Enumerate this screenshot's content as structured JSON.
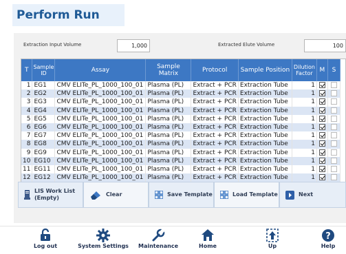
{
  "page": {
    "title": "Perform Run"
  },
  "volumes": {
    "extraction_input_label": "Extraction Input Volume",
    "extraction_input_value": "1,000",
    "extracted_elute_label": "Extracted Elute Volume",
    "extracted_elute_value": "100"
  },
  "table": {
    "headers": [
      "T",
      "Sample ID",
      "Assay",
      "Sample Matrix",
      "Protocol",
      "Sample Position",
      "Dilution Factor",
      "M",
      "S"
    ],
    "rows": [
      {
        "t": "1",
        "sample_id": "EG1",
        "assay": "CMV ELITe_PL_1000_100_01",
        "matrix": "Plasma (PL)",
        "protocol": "Extract + PCR",
        "position": "Extraction Tube",
        "dilution": "1",
        "m": true,
        "s": false
      },
      {
        "t": "2",
        "sample_id": "EG2",
        "assay": "CMV ELITe_PL_1000_100_01",
        "matrix": "Plasma (PL)",
        "protocol": "Extract + PCR",
        "position": "Extraction Tube",
        "dilution": "1",
        "m": true,
        "s": false
      },
      {
        "t": "3",
        "sample_id": "EG3",
        "assay": "CMV ELITe_PL_1000_100_01",
        "matrix": "Plasma (PL)",
        "protocol": "Extract + PCR",
        "position": "Extraction Tube",
        "dilution": "1",
        "m": true,
        "s": false
      },
      {
        "t": "4",
        "sample_id": "EG4",
        "assay": "CMV ELITe_PL_1000_100_01",
        "matrix": "Plasma (PL)",
        "protocol": "Extract + PCR",
        "position": "Extraction Tube",
        "dilution": "1",
        "m": true,
        "s": false
      },
      {
        "t": "5",
        "sample_id": "EG5",
        "assay": "CMV ELITe_PL_1000_100_01",
        "matrix": "Plasma (PL)",
        "protocol": "Extract + PCR",
        "position": "Extraction Tube",
        "dilution": "1",
        "m": true,
        "s": false
      },
      {
        "t": "6",
        "sample_id": "EG6",
        "assay": "CMV ELITe_PL_1000_100_01",
        "matrix": "Plasma (PL)",
        "protocol": "Extract + PCR",
        "position": "Extraction Tube",
        "dilution": "1",
        "m": true,
        "s": false
      },
      {
        "t": "7",
        "sample_id": "EG7",
        "assay": "CMV ELITe_PL_1000_100_01",
        "matrix": "Plasma (PL)",
        "protocol": "Extract + PCR",
        "position": "Extraction Tube",
        "dilution": "1",
        "m": true,
        "s": false
      },
      {
        "t": "8",
        "sample_id": "EG8",
        "assay": "CMV ELITe_PL_1000_100_01",
        "matrix": "Plasma (PL)",
        "protocol": "Extract + PCR",
        "position": "Extraction Tube",
        "dilution": "1",
        "m": true,
        "s": false
      },
      {
        "t": "9",
        "sample_id": "EG9",
        "assay": "CMV ELITe_PL_1000_100_01",
        "matrix": "Plasma (PL)",
        "protocol": "Extract + PCR",
        "position": "Extraction Tube",
        "dilution": "1",
        "m": true,
        "s": false
      },
      {
        "t": "10",
        "sample_id": "EG10",
        "assay": "CMV ELITe_PL_1000_100_01",
        "matrix": "Plasma (PL)",
        "protocol": "Extract + PCR",
        "position": "Extraction Tube",
        "dilution": "1",
        "m": true,
        "s": false
      },
      {
        "t": "11",
        "sample_id": "EG11",
        "assay": "CMV ELITe_PL_1000_100_01",
        "matrix": "Plasma (PL)",
        "protocol": "Extract + PCR",
        "position": "Extraction Tube",
        "dilution": "1",
        "m": true,
        "s": false
      },
      {
        "t": "12",
        "sample_id": "EG12",
        "assay": "CMV ELITe_PL_1000_100_01",
        "matrix": "Plasma (PL)",
        "protocol": "Extract + PCR",
        "position": "Extraction Tube",
        "dilution": "1",
        "m": true,
        "s": false
      }
    ]
  },
  "toolbar": {
    "lis_label": "LIS Work List",
    "lis_status": "(Empty)",
    "clear_label": "Clear",
    "save_template_label": "Save Template",
    "load_template_label": "Load Template",
    "next_label": "Next"
  },
  "bottom_nav": {
    "logout": "Log out",
    "system_settings": "System Settings",
    "maintenance": "Maintenance",
    "home": "Home",
    "up": "Up",
    "help": "Help"
  },
  "colors": {
    "title": "#1f5a96",
    "table_header": "#3d78c4",
    "row_alt": "#dbe5f4",
    "toolbar_bg": "#e7eef7"
  }
}
